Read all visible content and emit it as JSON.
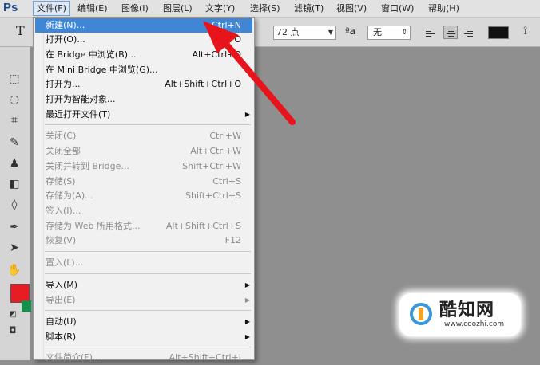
{
  "app": {
    "logo": "Ps"
  },
  "menubar": [
    {
      "label": "文件(F)",
      "active": true
    },
    {
      "label": "编辑(E)"
    },
    {
      "label": "图像(I)"
    },
    {
      "label": "图层(L)"
    },
    {
      "label": "文字(Y)"
    },
    {
      "label": "选择(S)"
    },
    {
      "label": "滤镜(T)"
    },
    {
      "label": "视图(V)"
    },
    {
      "label": "窗口(W)"
    },
    {
      "label": "帮助(H)"
    }
  ],
  "options_bar": {
    "tool_glyph": "T",
    "font_size": "72 点",
    "antialias_icon": "ªa",
    "antialias_value": "无",
    "text_color": "#111111"
  },
  "file_menu": {
    "items": [
      {
        "label": "新建(N)...",
        "shortcut": "Ctrl+N",
        "highlighted": true
      },
      {
        "label": "打开(O)...",
        "shortcut": "Ctrl+O"
      },
      {
        "label": "在 Bridge 中浏览(B)...",
        "shortcut": "Alt+Ctrl+O"
      },
      {
        "label": "在 Mini Bridge 中浏览(G)...",
        "shortcut": ""
      },
      {
        "label": "打开为...",
        "shortcut": "Alt+Shift+Ctrl+O"
      },
      {
        "label": "打开为智能对象...",
        "shortcut": ""
      },
      {
        "label": "最近打开文件(T)",
        "shortcut": "",
        "submenu": true
      },
      {
        "label": "关闭(C)",
        "shortcut": "Ctrl+W",
        "disabled": true
      },
      {
        "label": "关闭全部",
        "shortcut": "Alt+Ctrl+W",
        "disabled": true
      },
      {
        "label": "关闭并转到 Bridge...",
        "shortcut": "Shift+Ctrl+W",
        "disabled": true
      },
      {
        "label": "存储(S)",
        "shortcut": "Ctrl+S",
        "disabled": true
      },
      {
        "label": "存储为(A)...",
        "shortcut": "Shift+Ctrl+S",
        "disabled": true
      },
      {
        "label": "签入(I)...",
        "shortcut": "",
        "disabled": true
      },
      {
        "label": "存储为 Web 所用格式...",
        "shortcut": "Alt+Shift+Ctrl+S",
        "disabled": true
      },
      {
        "label": "恢复(V)",
        "shortcut": "F12",
        "disabled": true
      },
      {
        "label": "置入(L)...",
        "shortcut": "",
        "disabled": true
      },
      {
        "label": "导入(M)",
        "shortcut": "",
        "submenu": true
      },
      {
        "label": "导出(E)",
        "shortcut": "",
        "submenu": true,
        "disabled": true
      },
      {
        "label": "自动(U)",
        "shortcut": "",
        "submenu": true
      },
      {
        "label": "脚本(R)",
        "shortcut": "",
        "submenu": true
      },
      {
        "label": "文件简介(F)...",
        "shortcut": "Alt+Shift+Ctrl+I"
      }
    ]
  },
  "swatches": {
    "foreground": "#e61e24",
    "background": "#12914a"
  },
  "watermark": {
    "name": "酷知网",
    "url": "www.coozhi.com"
  },
  "annotation": {
    "arrow_color": "#e8141b"
  }
}
